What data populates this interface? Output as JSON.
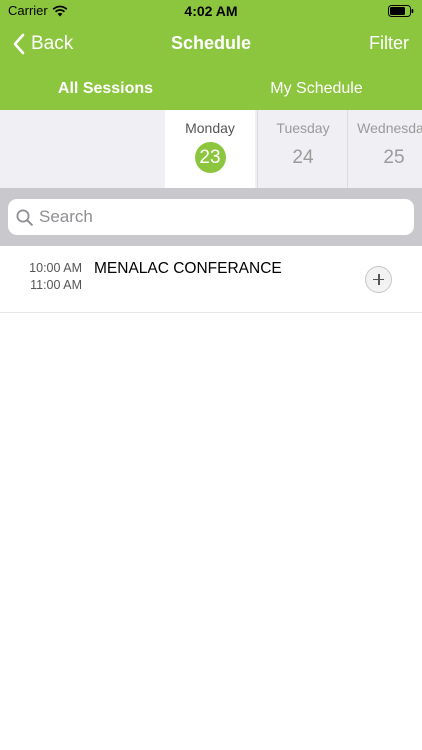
{
  "status_bar": {
    "carrier": "Carrier",
    "time": "4:02 AM"
  },
  "nav": {
    "back_label": "Back",
    "title": "Schedule",
    "filter_label": "Filter"
  },
  "tabs": [
    {
      "label": "All Sessions",
      "active": true
    },
    {
      "label": "My Schedule",
      "active": false
    }
  ],
  "days": [
    {
      "name": "Monday",
      "number": "23",
      "selected": true
    },
    {
      "name": "Tuesday",
      "number": "24",
      "selected": false
    },
    {
      "name": "Wednesday",
      "number": "25",
      "selected": false
    }
  ],
  "search": {
    "placeholder": "Search",
    "value": ""
  },
  "sessions": [
    {
      "start": "10:00 AM",
      "end": "11:00 AM",
      "title": "MENALAC CONFERANCE"
    }
  ],
  "colors": {
    "accent": "#8cc63f",
    "date_bar": "#efeff4",
    "search_bar": "#c8c8cd"
  }
}
